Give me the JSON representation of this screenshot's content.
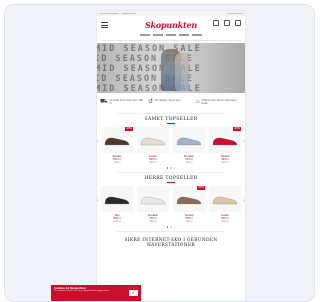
{
  "site": {
    "logo_text": "Skopunkten",
    "brand_color": "#c8102e"
  },
  "hero": {
    "rows": [
      "MID SEASON SALE",
      "MID SEASON SALE",
      "MID SEASON SALE",
      "MID SEASON SALE",
      "MID SEASON SALE"
    ]
  },
  "usp": [
    {
      "icon": "truck-icon",
      "glyph": "⛟",
      "text": "Fri frakt & fri retur över 499 kr"
    },
    {
      "icon": "return-icon",
      "glyph": "↺",
      "text": "30 dagars öppet köp"
    },
    {
      "icon": "store-icon",
      "glyph": "⌂",
      "text": "Välkommen till din närmaste butik"
    }
  ],
  "section1": {
    "title": "SAMET TOPSELLER",
    "products": [
      {
        "name": "Sandal",
        "price": "599 kr",
        "old": "799 kr",
        "badge": "-25%",
        "color": "#4a3a30"
      },
      {
        "name": "Loafer",
        "price": "699 kr",
        "old": "899 kr",
        "badge": "",
        "color": "#e6dccd"
      },
      {
        "name": "Sneaker",
        "price": "799 kr",
        "old": "999 kr",
        "badge": "",
        "color": "#9fb3c8"
      },
      {
        "name": "Sandal",
        "price": "499 kr",
        "old": "699 kr",
        "badge": "-30%",
        "color": "#c8102e"
      }
    ]
  },
  "section2": {
    "title": "HERRE TOPSELLER",
    "products": [
      {
        "name": "Sko",
        "price": "899 kr",
        "old": "1199 kr",
        "badge": "",
        "color": "#2a2a2a"
      },
      {
        "name": "Sneaker",
        "price": "799 kr",
        "old": "999 kr",
        "badge": "",
        "color": "#e8e8e8"
      },
      {
        "name": "Sandal",
        "price": "599 kr",
        "old": "799 kr",
        "badge": "-25%",
        "color": "#8a6a52"
      },
      {
        "name": "Loafer",
        "price": "699 kr",
        "old": "899 kr",
        "badge": "",
        "color": "#d9c7a8"
      }
    ]
  },
  "bottom": {
    "title": "SIKRE INTERNET-SKO I GEBUNDEN HAVERSTATIONER"
  },
  "cookie": {
    "title": "Cookies på Skopunkten",
    "text": "Vi använder cookies för att ge dig den bästa upplevelsen.",
    "button": "✓"
  }
}
